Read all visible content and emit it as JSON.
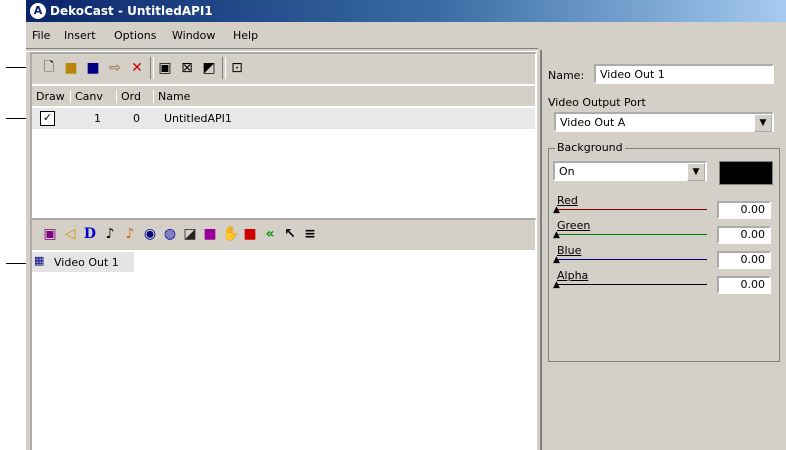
{
  "window": {
    "title": "DekoCast - UntitledAPI1",
    "app_icon_letter": "A"
  },
  "menu": [
    "File",
    "Insert",
    "Options",
    "Window",
    "Help"
  ],
  "columns": [
    "Draw",
    "Canv",
    "Ord",
    "Name"
  ],
  "row": {
    "checked": "✓",
    "canv": "1",
    "ord": "0",
    "name": "UntitledAPI1"
  },
  "video_item": {
    "label": "Video Out 1"
  },
  "props": {
    "name_label": "Name:",
    "name_value": "Video Out 1",
    "port_label": "Video Output Port",
    "port_value": "Video Out A",
    "background_label": "Background",
    "background_value": "On",
    "background_color": "#000000",
    "sliders": [
      {
        "label": "Red",
        "value": "0.00",
        "color": "#800000"
      },
      {
        "label": "Green",
        "value": "0.00",
        "color": "#008000"
      },
      {
        "label": "Blue",
        "value": "0.00",
        "color": "#000080"
      },
      {
        "label": "Alpha",
        "value": "0.00",
        "color": "#000000"
      }
    ]
  }
}
